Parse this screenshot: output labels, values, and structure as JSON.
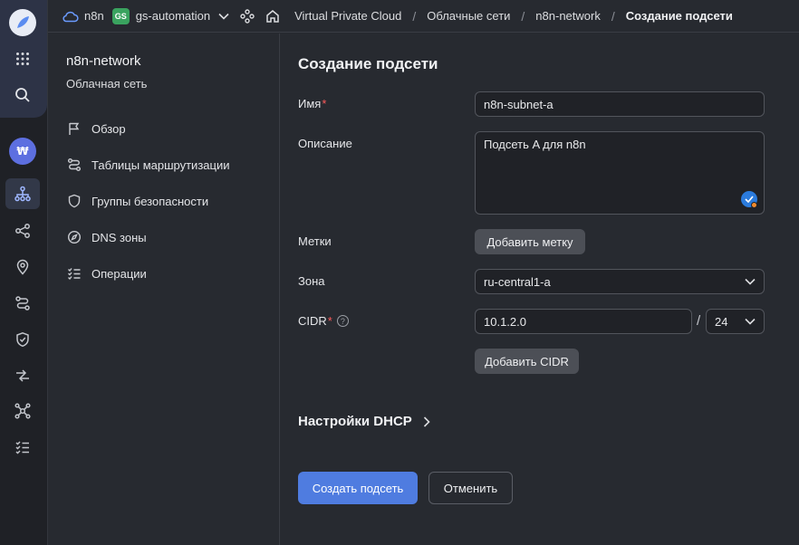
{
  "header": {
    "org": "n8n",
    "project_badge": "GS",
    "project": "gs-automation",
    "breadcrumbs": [
      "Virtual Private Cloud",
      "Облачные сети",
      "n8n-network",
      "Создание подсети"
    ]
  },
  "sidebar": {
    "title": "n8n-network",
    "subtitle": "Облачная сеть",
    "items": [
      {
        "label": "Обзор",
        "icon": "flag-icon"
      },
      {
        "label": "Таблицы маршрутизации",
        "icon": "route-icon"
      },
      {
        "label": "Группы безопасности",
        "icon": "shield-icon"
      },
      {
        "label": "DNS зоны",
        "icon": "compass-icon"
      },
      {
        "label": "Операции",
        "icon": "list-icon"
      }
    ]
  },
  "form": {
    "title": "Создание подсети",
    "name_label": "Имя",
    "name_value": "n8n-subnet-a",
    "description_label": "Описание",
    "description_value": "Подсеть A для n8n",
    "labels_label": "Метки",
    "add_label_button": "Добавить метку",
    "zone_label": "Зона",
    "zone_value": "ru-central1-a",
    "cidr_label": "CIDR",
    "cidr_value": "10.1.2.0",
    "cidr_separator": "/",
    "cidr_mask": "24",
    "add_cidr_button": "Добавить CIDR",
    "dhcp_label": "Настройки DHCP",
    "submit_button": "Создать подсеть",
    "cancel_button": "Отменить",
    "required_mark": "*",
    "help_mark": "?"
  },
  "colors": {
    "accent": "#4f7ce0",
    "required": "#ff5b5b",
    "badge_green": "#3aa35f"
  }
}
